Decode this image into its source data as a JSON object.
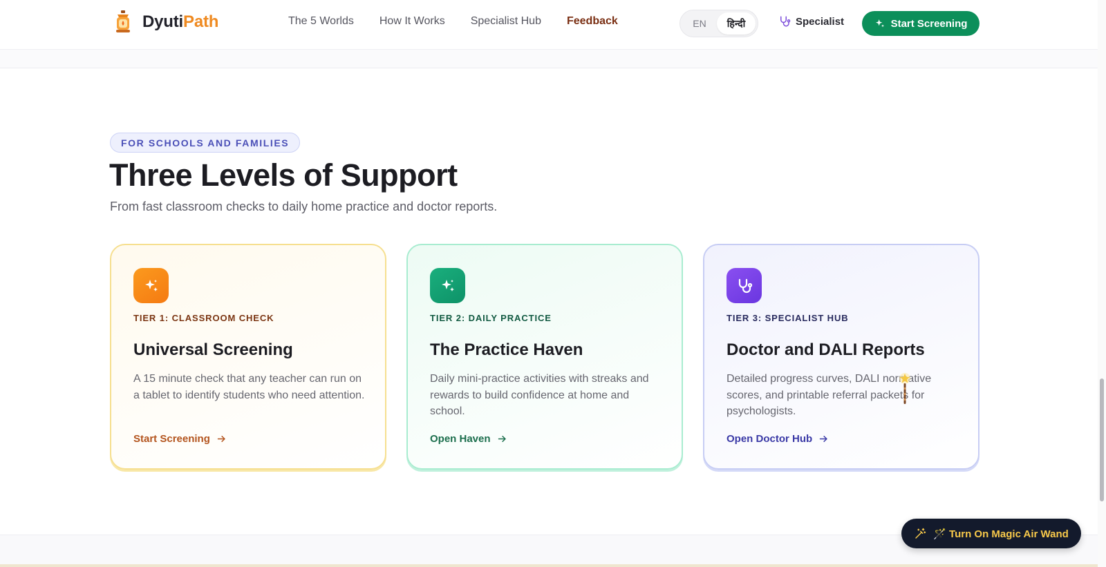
{
  "brand": {
    "name_main": "Dyuti",
    "name_accent": "Path"
  },
  "nav": [
    "The 5 Worlds",
    "How It Works",
    "Specialist Hub",
    "Feedback"
  ],
  "language": {
    "en": "EN",
    "hi": "हिन्दी"
  },
  "header": {
    "specialist_label": "Specialist",
    "cta_label": "Start Screening"
  },
  "section": {
    "eyebrow": "FOR SCHOOLS AND FAMILIES",
    "title": "Three Levels of Support",
    "subtitle": "From fast classroom checks to daily home practice and doctor reports."
  },
  "cards": [
    {
      "tier": "TIER 1: CLASSROOM CHECK",
      "title": "Universal Screening",
      "description": "A 15 minute check that any teacher can run on a tablet to identify students who need attention.",
      "link": "Start Screening",
      "icon": "sparkle-icon"
    },
    {
      "tier": "TIER 2: DAILY PRACTICE",
      "title": "The Practice Haven",
      "description": "Daily mini-practice activities with streaks and rewards to build confidence at home and school.",
      "link": "Open Haven",
      "icon": "sparkle-icon"
    },
    {
      "tier": "TIER 3: SPECIALIST HUB",
      "title": "Doctor and DALI Reports",
      "description": "Detailed progress curves, DALI normative scores, and printable referral packets for psychologists.",
      "link": "Open Doctor Hub",
      "icon": "stethoscope-icon"
    }
  ],
  "magic_wand": {
    "label": "🪄 Turn On Magic Air Wand"
  },
  "colors": {
    "primary_green": "#0c8f5a",
    "brand_orange": "#ef8a21",
    "feedback": "#7a2f13",
    "tier1": "#f57a12",
    "tier2": "#0e9268",
    "tier3": "#6a36e0",
    "wand_bg": "#131a2c",
    "wand_text": "#f8c94a"
  }
}
